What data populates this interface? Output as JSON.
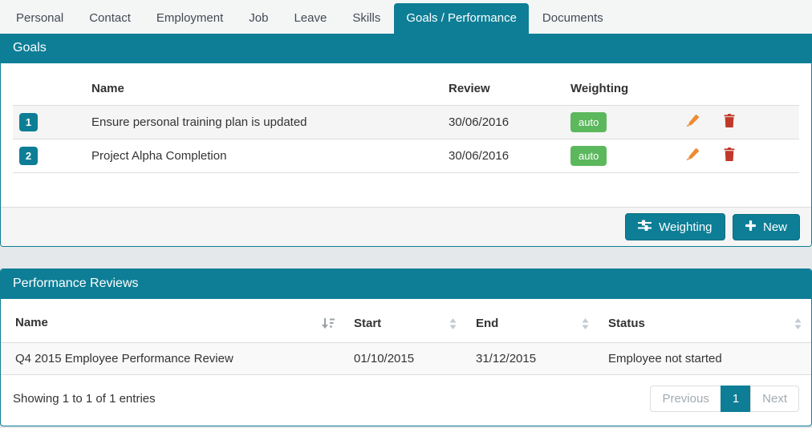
{
  "tabs": {
    "items": [
      {
        "label": "Personal",
        "active": false
      },
      {
        "label": "Contact",
        "active": false
      },
      {
        "label": "Employment",
        "active": false
      },
      {
        "label": "Job",
        "active": false
      },
      {
        "label": "Leave",
        "active": false
      },
      {
        "label": "Skills",
        "active": false
      },
      {
        "label": "Goals / Performance",
        "active": true
      },
      {
        "label": "Documents",
        "active": false
      }
    ]
  },
  "goals": {
    "title": "Goals",
    "columns": {
      "name": "Name",
      "review": "Review",
      "weighting": "Weighting"
    },
    "rows": [
      {
        "num": "1",
        "name": "Ensure personal training plan is updated",
        "review": "30/06/2016",
        "weighting": "auto"
      },
      {
        "num": "2",
        "name": "Project Alpha Completion",
        "review": "30/06/2016",
        "weighting": "auto"
      }
    ],
    "buttons": {
      "weighting": "Weighting",
      "new": "New"
    }
  },
  "reviews": {
    "title": "Performance Reviews",
    "columns": {
      "name": "Name",
      "start": "Start",
      "end": "End",
      "status": "Status"
    },
    "rows": [
      {
        "name": "Q4 2015 Employee Performance Review",
        "start": "01/10/2015",
        "end": "31/12/2015",
        "status": "Employee not started"
      }
    ],
    "summary": "Showing 1 to 1 of 1 entries",
    "pagination": {
      "previous": "Previous",
      "page": "1",
      "next": "Next"
    }
  },
  "colors": {
    "teal": "#0d7e96",
    "green": "#5cb85c",
    "pencil": "#ee8b33",
    "trash": "#c0392b"
  }
}
